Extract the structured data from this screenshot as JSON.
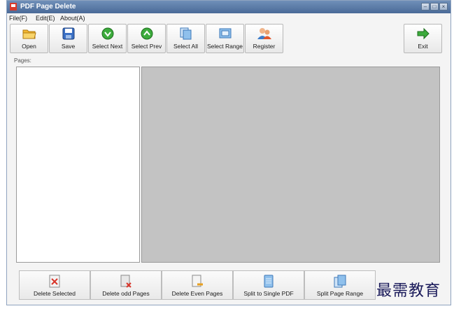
{
  "window": {
    "title": "PDF Page Delete"
  },
  "menu": [
    {
      "label": "File(F)"
    },
    {
      "label": "Edit(E)"
    },
    {
      "label": "About(A)"
    }
  ],
  "toolbar": [
    {
      "label": "Open",
      "icon": "open-folder-icon"
    },
    {
      "label": "Save",
      "icon": "save-disk-icon"
    },
    {
      "label": "Select Next",
      "icon": "arrow-down-circle-icon"
    },
    {
      "label": "Select Prev",
      "icon": "arrow-up-circle-icon"
    },
    {
      "label": "Select All",
      "icon": "select-all-pages-icon"
    },
    {
      "label": "Select Range",
      "icon": "select-range-icon"
    },
    {
      "label": "Register",
      "icon": "users-icon"
    }
  ],
  "exit": {
    "label": "Exit",
    "icon": "exit-arrow-icon"
  },
  "pages_label": "Pages:",
  "bottom": [
    {
      "label": "Delete Selected",
      "icon": "delete-page-icon"
    },
    {
      "label": "Delete odd Pages",
      "icon": "delete-odd-icon"
    },
    {
      "label": "Delete Even Pages",
      "icon": "delete-even-icon"
    },
    {
      "label": "Split to Single PDF",
      "icon": "split-single-icon"
    },
    {
      "label": "Split Page Range",
      "icon": "split-range-icon"
    }
  ],
  "watermark": "最需教育",
  "colors": {
    "titlebar": "#4a6a98",
    "preview_bg": "#c3c3c3",
    "green_icon": "#3cab3c"
  }
}
